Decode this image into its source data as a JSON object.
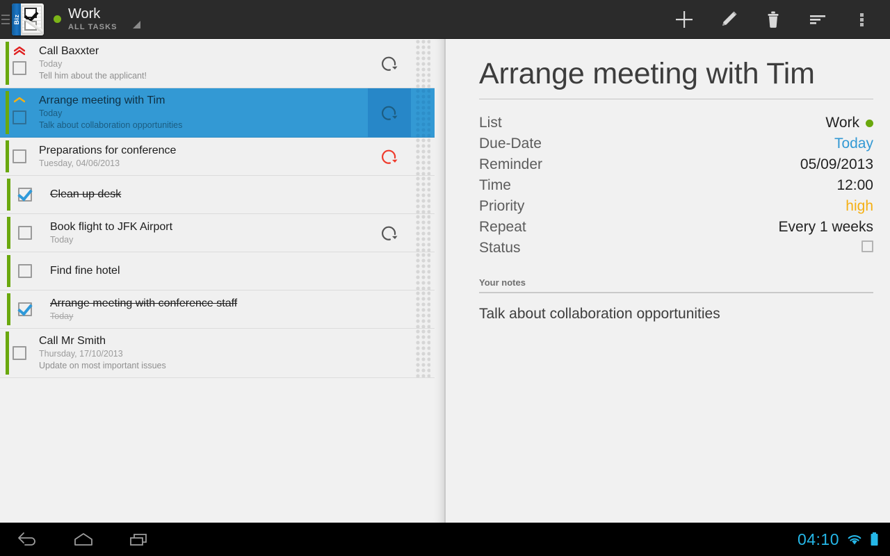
{
  "actionbar": {
    "app_icon": "biz-notepad-checklist-icon",
    "drawer_icon": "drawer-handle-icon",
    "list_dot_color": "#7cb518",
    "title": "Work",
    "subtitle": "ALL TASKS",
    "spine_label": "Biz",
    "caret_icon": "dropdown-caret-icon",
    "actions": [
      {
        "name": "add-task-button",
        "icon": "plus-icon",
        "label": "Add"
      },
      {
        "name": "edit-task-button",
        "icon": "pencil-icon",
        "label": "Edit"
      },
      {
        "name": "delete-task-button",
        "icon": "trash-icon",
        "label": "Delete"
      },
      {
        "name": "sort-button",
        "icon": "sort-lines-icon",
        "label": "Sort"
      },
      {
        "name": "overflow-button",
        "icon": "more-vertical-icon",
        "label": "More options"
      }
    ]
  },
  "tasks": [
    {
      "title": "Call Baxxter",
      "date": "Today",
      "note": "Tell him about the applicant!",
      "checked": false,
      "selected": false,
      "sub": false,
      "priority": "highest",
      "priority_color": "#e02020",
      "repeat": true,
      "repeat_overdue": false
    },
    {
      "title": "Arrange meeting with Tim",
      "date": "Today",
      "note": "Talk about collaboration opportunities",
      "checked": false,
      "selected": true,
      "sub": false,
      "priority": "high",
      "priority_color": "#f5b014",
      "repeat": true,
      "repeat_overdue": false
    },
    {
      "title": "Preparations for conference",
      "date": "Tuesday, 04/06/2013",
      "note": "",
      "checked": false,
      "selected": false,
      "sub": false,
      "priority": "none",
      "priority_color": "",
      "repeat": true,
      "repeat_overdue": true
    },
    {
      "title": "Clean up desk",
      "date": "",
      "note": "",
      "checked": true,
      "selected": false,
      "sub": true,
      "priority": "none",
      "priority_color": "",
      "repeat": false,
      "repeat_overdue": false
    },
    {
      "title": "Book flight to JFK Airport",
      "date": "Today",
      "note": "",
      "checked": false,
      "selected": false,
      "sub": true,
      "priority": "none",
      "priority_color": "",
      "repeat": true,
      "repeat_overdue": false
    },
    {
      "title": "Find fine hotel",
      "date": "",
      "note": "",
      "checked": false,
      "selected": false,
      "sub": true,
      "priority": "none",
      "priority_color": "",
      "repeat": false,
      "repeat_overdue": false
    },
    {
      "title": "Arrange meeting with conference staff",
      "date": "Today",
      "note": "",
      "checked": true,
      "selected": false,
      "sub": true,
      "priority": "none",
      "priority_color": "",
      "repeat": false,
      "repeat_overdue": false
    },
    {
      "title": "Call Mr Smith",
      "date": "Thursday, 17/10/2013",
      "note": "Update on most important issues",
      "checked": false,
      "selected": false,
      "sub": false,
      "priority": "none",
      "priority_color": "",
      "repeat": false,
      "repeat_overdue": false
    }
  ],
  "detail": {
    "title": "Arrange meeting with Tim",
    "fields": [
      {
        "label": "List",
        "value": "Work",
        "style": "dot"
      },
      {
        "label": "Due-Date",
        "value": "Today",
        "style": "accent"
      },
      {
        "label": "Reminder",
        "value": "05/09/2013",
        "style": "plain"
      },
      {
        "label": "Time",
        "value": "12:00",
        "style": "plain"
      },
      {
        "label": "Priority",
        "value": "high",
        "style": "prio-high"
      },
      {
        "label": "Repeat",
        "value": "Every 1 weeks",
        "style": "plain"
      },
      {
        "label": "Status",
        "value": "",
        "style": "checkbox"
      }
    ],
    "notes_label": "Your notes",
    "notes_text": "Talk about collaboration opportunities",
    "list_dot_color": "#6aa80d",
    "accent_color": "#3399d4",
    "priority_color": "#f5b014"
  },
  "navbar": {
    "buttons": [
      {
        "name": "nav-back-button",
        "icon": "back-arrow-icon",
        "label": "Back"
      },
      {
        "name": "nav-home-button",
        "icon": "home-icon",
        "label": "Home"
      },
      {
        "name": "nav-recents-button",
        "icon": "recents-icon",
        "label": "Recent apps"
      }
    ],
    "clock": "04:10",
    "wifi_icon": "wifi-icon",
    "battery_icon": "battery-full-icon",
    "status_color": "#25b7e8"
  }
}
